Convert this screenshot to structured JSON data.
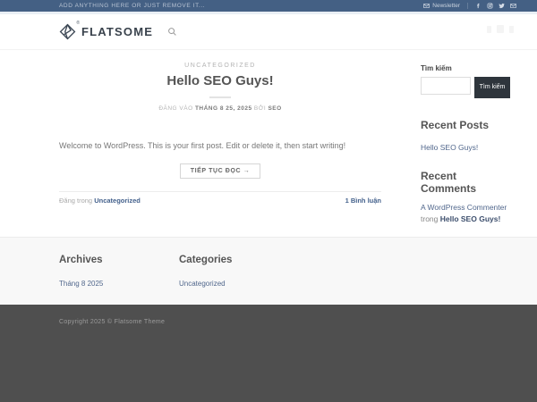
{
  "topbar": {
    "message": "ADD ANYTHING HERE OR JUST REMOVE IT...",
    "newsletter_label": "Newsletter",
    "social_icons": [
      "facebook",
      "instagram",
      "twitter",
      "email"
    ]
  },
  "header": {
    "logo_text": "FLATSOME",
    "registered_mark": "®",
    "icons": [
      "flatsome-diamond-logo",
      "search-magnifier"
    ]
  },
  "post": {
    "category": "UNCATEGORIZED",
    "title": "Hello SEO Guys!",
    "byline": {
      "prefix": "ĐĂNG VÀO",
      "date": "THÁNG 8 25, 2025",
      "by": "BỞI",
      "author": "SEO"
    },
    "excerpt": "Welcome to WordPress. This is your first post. Edit or delete it, then start writing!",
    "read_more_label": "TIẾP TỤC ĐỌC →",
    "posted_in_label": "Đăng trong",
    "category_link": "Uncategorized",
    "comments_link": "1 Bình luận"
  },
  "sidebar": {
    "search": {
      "label": "Tìm kiếm",
      "input_value": "",
      "input_placeholder": "",
      "button_label": "Tìm kiếm"
    },
    "recent_posts": {
      "heading": "Recent Posts",
      "items": [
        "Hello SEO Guys!"
      ]
    },
    "recent_comments": {
      "heading": "Recent Comments",
      "items": [
        {
          "author": "A WordPress Commenter",
          "connector": "trong",
          "post": "Hello SEO Guys!"
        }
      ]
    }
  },
  "footer": {
    "archives": {
      "heading": "Archives",
      "items": [
        "Tháng 8 2025"
      ]
    },
    "categories": {
      "heading": "Categories",
      "items": [
        "Uncategorized"
      ]
    },
    "copyright": "Copyright 2025 © Flatsome Theme"
  },
  "colors": {
    "topbar_bg": "#446084",
    "search_button_bg": "#2e353c",
    "link": "#51678c",
    "dark_footer_bg": "#4f4f4f",
    "footer_widgets_bg": "#f8f8f8"
  }
}
